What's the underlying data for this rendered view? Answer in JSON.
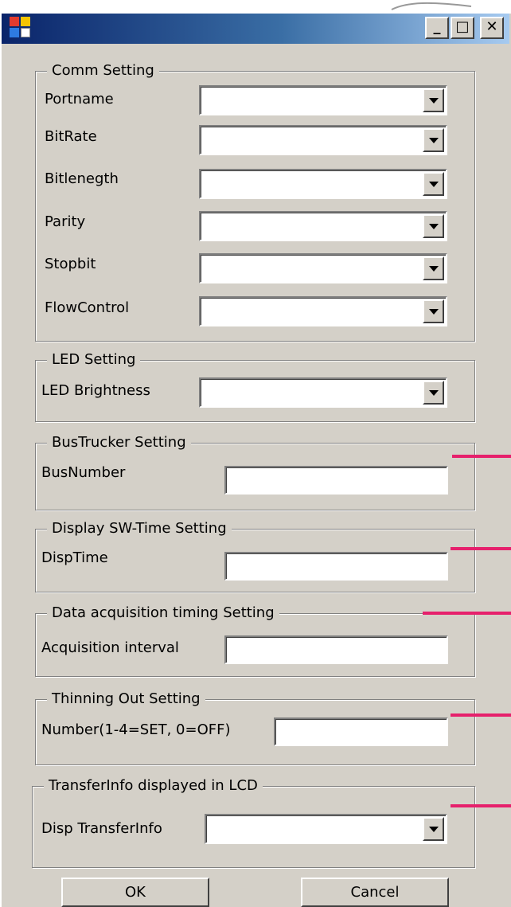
{
  "window": {
    "minimize_glyph": "_",
    "maximize_glyph": "□",
    "close_glyph": "✕"
  },
  "comm": {
    "legend": "Comm Setting",
    "fields": [
      {
        "label": "Portname",
        "value": ""
      },
      {
        "label": "BitRate",
        "value": ""
      },
      {
        "label": "Bitlenegth",
        "value": ""
      },
      {
        "label": "Parity",
        "value": ""
      },
      {
        "label": "Stopbit",
        "value": ""
      },
      {
        "label": "FlowControl",
        "value": ""
      }
    ]
  },
  "led": {
    "legend": "LED Setting",
    "label": "LED Brightness",
    "value": ""
  },
  "bus": {
    "legend": "BusTrucker Setting",
    "label": "BusNumber",
    "value": ""
  },
  "disp": {
    "legend": "Display SW-Time Setting",
    "label": "DispTime",
    "value": ""
  },
  "acq": {
    "legend": "Data acquisition timing Setting",
    "label": "Acquisition interval",
    "value": ""
  },
  "thin": {
    "legend": "Thinning Out Setting",
    "label": "Number(1-4=SET, 0=OFF)",
    "value": ""
  },
  "transfer": {
    "legend": "TransferInfo displayed in LCD",
    "label": "Disp TransferInfo",
    "value": ""
  },
  "buttons": {
    "ok": "OK",
    "cancel": "Cancel"
  },
  "colors": {
    "marker": "#e6206c",
    "face": "#d4d0c8",
    "title_start": "#0a246a"
  }
}
